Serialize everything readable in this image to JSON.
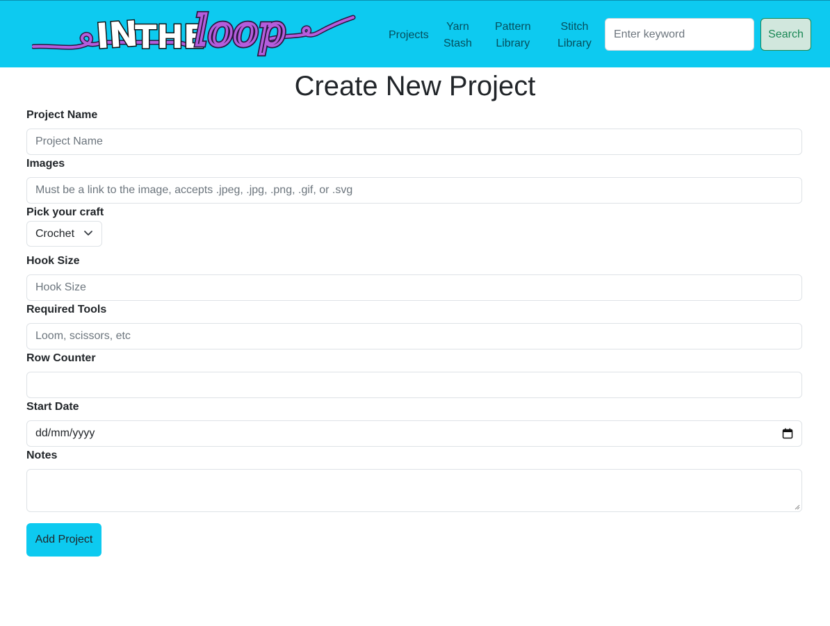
{
  "brand": {
    "logo_text_1": "IN",
    "logo_text_2": "THE",
    "logo_text_3": "loop",
    "colors": {
      "navbar": "#0dcaf0",
      "yarn": "#b45ddc",
      "search_button_bg": "#d1e7dd",
      "search_button_text": "#198754"
    }
  },
  "nav": {
    "items": [
      {
        "line1": "Projects",
        "line2": ""
      },
      {
        "line1": "Yarn",
        "line2": "Stash"
      },
      {
        "line1": "Pattern",
        "line2": "Library"
      },
      {
        "line1": "Stitch",
        "line2": "Library"
      }
    ],
    "search_placeholder": "Enter keyword",
    "search_button": "Search"
  },
  "page": {
    "title": "Create New Project"
  },
  "form": {
    "project_name": {
      "label": "Project Name",
      "placeholder": "Project Name"
    },
    "images": {
      "label": "Images",
      "placeholder": "Must be a link to the image, accepts .jpeg, .jpg, .png, .gif, or .svg"
    },
    "craft": {
      "label": "Pick your craft",
      "selected": "Crochet",
      "icon": "chevron-down-icon"
    },
    "hook_size": {
      "label": "Hook Size",
      "placeholder": "Hook Size"
    },
    "required_tools": {
      "label": "Required Tools",
      "placeholder": "Loom, scissors, etc"
    },
    "row_counter": {
      "label": "Row Counter",
      "placeholder": ""
    },
    "start_date": {
      "label": "Start Date",
      "value": "dd/mm/yyyy",
      "icon": "calendar-icon"
    },
    "notes": {
      "label": "Notes"
    },
    "submit": "Add Project"
  }
}
